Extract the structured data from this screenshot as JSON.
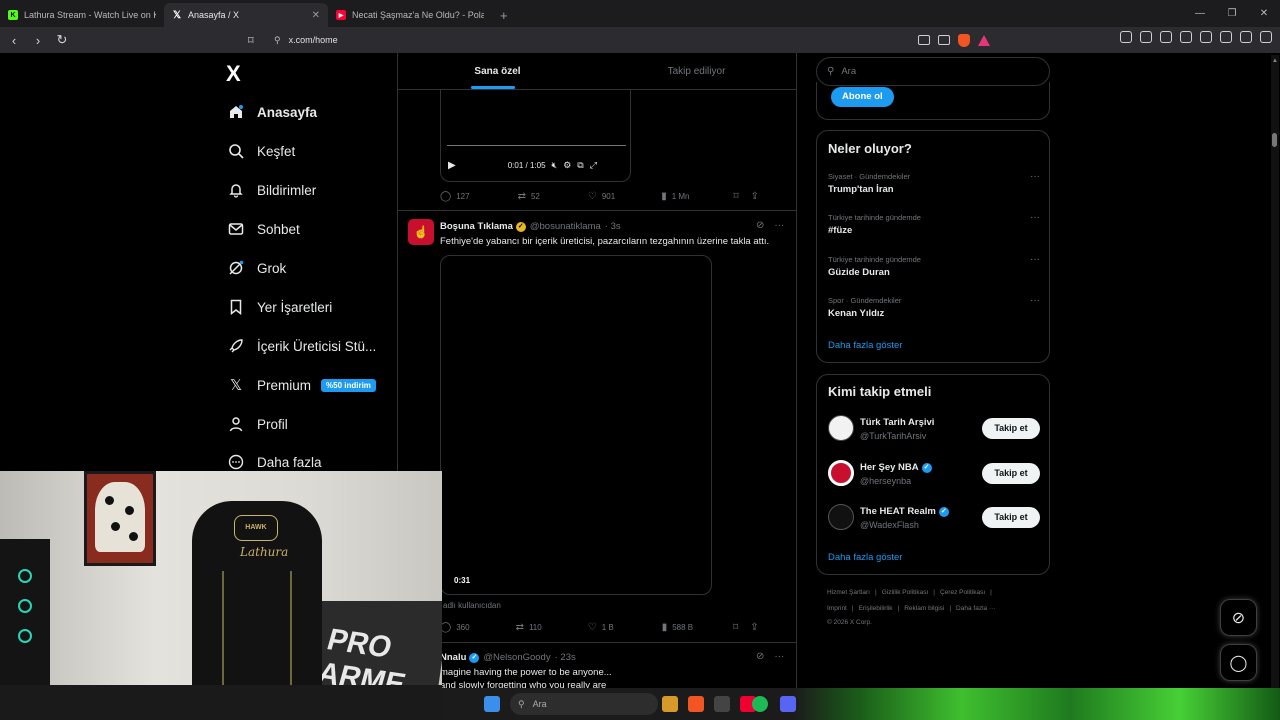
{
  "browser": {
    "tabs": [
      {
        "title": "Lathura Stream - Watch Live on Kick",
        "active": false,
        "favicon": "kick-icon"
      },
      {
        "title": "Anasayfa / X",
        "active": true,
        "favicon": "x-icon"
      },
      {
        "title": "Necati Şaşmaz'a Ne Oldu? - Polat Al",
        "active": false,
        "favicon": "youtube-icon"
      }
    ],
    "new_tab": "+",
    "url": "x.com/home"
  },
  "nav": {
    "logo": "X",
    "items": [
      {
        "label": "Anasayfa",
        "icon": "home-icon"
      },
      {
        "label": "Keşfet",
        "icon": "search-icon"
      },
      {
        "label": "Bildirimler",
        "icon": "bell-icon"
      },
      {
        "label": "Sohbet",
        "icon": "mail-icon"
      },
      {
        "label": "Grok",
        "icon": "grok-icon"
      },
      {
        "label": "Yer İşaretleri",
        "icon": "bookmark-icon"
      },
      {
        "label": "İçerik Üreticisi Stü...",
        "icon": "rocket-icon"
      },
      {
        "label": "Premium",
        "icon": "x-icon",
        "badge": "%50 indirim"
      },
      {
        "label": "Profil",
        "icon": "person-icon"
      },
      {
        "label": "Daha fazla",
        "icon": "more-circle-icon"
      }
    ]
  },
  "feed": {
    "tabs": [
      "Sana özel",
      "Takip ediliyor"
    ],
    "video1": {
      "time": "0:01 / 1:05"
    },
    "tweet1_actions": {
      "replies": "127",
      "retweets": "52",
      "likes": "901",
      "views": "1 Mn"
    },
    "tweet2": {
      "name": "Boşuna Tıklama",
      "handle": "@bosunatiklama",
      "age": "· 3s",
      "text": "Fethiye'de yabancı bir içerik üreticisi, pazarcıların tezgahının üzerine takla attı.",
      "video_duration": "0:31",
      "from_user": "adlı kullanıcıdan"
    },
    "tweet2_actions": {
      "replies": "360",
      "retweets": "110",
      "likes": "1 B",
      "views": "588 B"
    },
    "tweet3": {
      "name": "Nnalu",
      "handle": "@NelsonGoody",
      "age": "· 23s",
      "line1": "magine having the power to be anyone...",
      "line2": "and slowly forgetting who you really are"
    }
  },
  "right": {
    "search_placeholder": "Ara",
    "subscribe_label": "Abone ol",
    "trends_title": "Neler oluyor?",
    "trends": [
      {
        "category": "Siyaset · Gündemdekiler",
        "name": "Trump'tan İran"
      },
      {
        "category": "Türkiye tarihinde gündemde",
        "name": "#füze"
      },
      {
        "category": "Türkiye tarihinde gündemde",
        "name": "Güzide Duran"
      },
      {
        "category": "Spor · Gündemdekiler",
        "name": "Kenan Yıldız"
      }
    ],
    "trends_more": "Daha fazla göster",
    "follow_title": "Kimi takip etmeli",
    "follow": [
      {
        "name": "Türk Tarih Arşivi",
        "handle": "@TurkTarihArsiv",
        "verified": false,
        "button": "Takip et"
      },
      {
        "name": "Her Şey NBA",
        "handle": "@herseynba",
        "verified": true,
        "button": "Takip et"
      },
      {
        "name": "The HEAT Realm",
        "handle": "@WadexFlash",
        "verified": true,
        "button": "Takip et"
      }
    ],
    "follow_more": "Daha fazla göster",
    "footer_line1": [
      "Hizmet Şartları",
      "|",
      "Gizlilik Politikası",
      "|",
      "Çerez Politikası",
      "|"
    ],
    "footer_line2": [
      "Imprint",
      "|",
      "Erişilebilirlik",
      "|",
      "Reklam bilgisi",
      "|",
      "Daha fazla ···"
    ],
    "footer_copy": "© 2026 X Corp."
  },
  "webcam": {
    "chair_brand": "Lathura",
    "chair_logo": "HAWK",
    "rug_text": "PRO ARME"
  },
  "taskbar": {
    "search_placeholder": "Ara"
  },
  "colors": {
    "accent": "#1d9bf0",
    "background": "#000000",
    "border": "#2f3336",
    "muted_text": "#71767b"
  }
}
